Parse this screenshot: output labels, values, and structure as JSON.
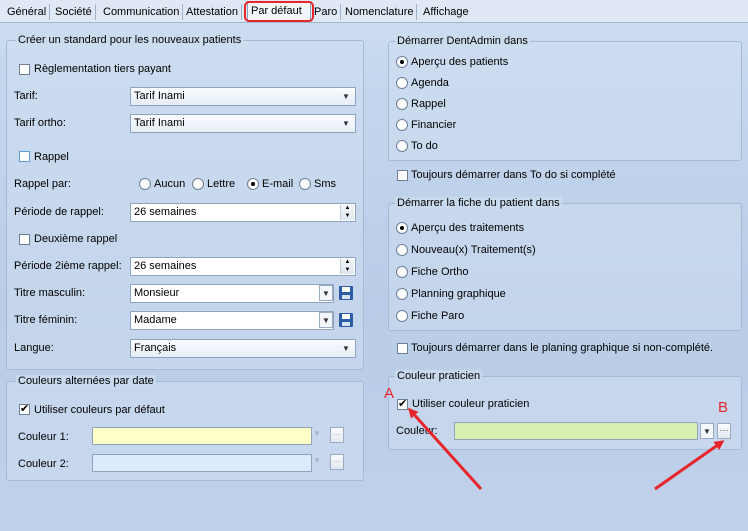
{
  "tabs": [
    "Général",
    "Société",
    "Communication",
    "Attestation",
    "Par défaut",
    "Paro",
    "Nomenclature",
    "Affichage"
  ],
  "active_tab": "Par défaut",
  "standard_group": {
    "title": "Créer un standard pour les nouveaux patients",
    "reglementation_label": "Règlementation tiers payant",
    "tarif_label": "Tarif:",
    "tarif_value": "Tarif Inami",
    "tarif_ortho_label": "Tarif ortho:",
    "tarif_ortho_value": "Tarif Inami",
    "rappel_label": "Rappel",
    "rappel_par_label": "Rappel par:",
    "rappel_options": [
      "Aucun",
      "Lettre",
      "E-mail",
      "Sms"
    ],
    "rappel_selected": "E-mail",
    "periode_label": "Période de rappel:",
    "periode_value": "26 semaines",
    "deuxieme_label": "Deuxième rappel",
    "periode2_label": "Période 2ième rappel:",
    "periode2_value": "26 semaines",
    "titre_masc_label": "Titre masculin:",
    "titre_masc_value": "Monsieur",
    "titre_fem_label": "Titre féminin:",
    "titre_fem_value": "Madame",
    "langue_label": "Langue:",
    "langue_value": "Français"
  },
  "colors_group": {
    "title": "Couleurs alternées par date",
    "use_default_label": "Utiliser couleurs par défaut",
    "color1_label": "Couleur 1:",
    "color2_label": "Couleur 2:",
    "color1": "#ffffc8",
    "color2": "#ddeafb"
  },
  "start_group": {
    "title": "Démarrer DentAdmin dans",
    "options": [
      "Aperçu des patients",
      "Agenda",
      "Rappel",
      "Financier",
      "To do"
    ],
    "selected": "Aperçu des patients",
    "todo_check_label": "Toujours démarrer dans To do si complété"
  },
  "fiche_group": {
    "title": "Démarrer la fiche du patient dans",
    "options": [
      "Aperçu des traitements",
      "Nouveau(x) Traitement(s)",
      "Fiche Ortho",
      "Planning graphique",
      "Fiche Paro"
    ],
    "selected": "Aperçu des traitements",
    "planning_check_label": "Toujours démarrer dans le planing graphique si non-complété."
  },
  "praticien_group": {
    "title": "Couleur praticien",
    "use_label": "Utiliser couleur praticien",
    "couleur_label": "Couleur:",
    "color": "#d8f0b0"
  },
  "annotations": {
    "label_a": "A",
    "label_b": "B",
    "accent": "#e8252b"
  }
}
